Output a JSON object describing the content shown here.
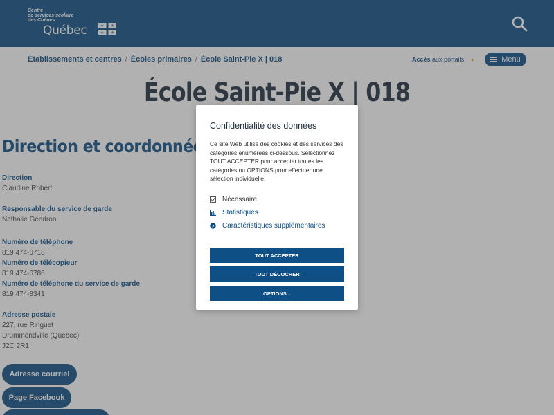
{
  "header": {
    "logo_line1": "Centre",
    "logo_line2": "de services scolaire",
    "logo_line3": "des Chênes",
    "logo_quebec": "Québec"
  },
  "breadcrumb": {
    "items": [
      "Établissements et centres",
      "Écoles primaires",
      "École Saint-Pie X | 018"
    ],
    "separator": "/"
  },
  "portals": {
    "bold": "Accès",
    "rest": "aux portails",
    "caret": "▼"
  },
  "menu": {
    "label": "Menu"
  },
  "page": {
    "title": "École Saint-Pie X | 018"
  },
  "contact": {
    "section_title": "Direction et coordonnées",
    "direction_label": "Direction",
    "direction_value": "Claudine Robert",
    "garde_label": "Responsable du service de garde",
    "garde_value": "Nathalie Gendron",
    "phone_label": "Numéro de téléphone",
    "phone_value": "819 474-0718",
    "fax_label": "Numéro de télécopieur",
    "fax_value": "819 474-0786",
    "garde_phone_label": "Numéro de téléphone du service de garde",
    "garde_phone_value": "819 474-8341",
    "address_label": "Adresse postale",
    "address_line1": "227, rue Ringuet",
    "address_line2": "Drummondville (Québec)",
    "address_line3": "J2C 2R1"
  },
  "buttons": {
    "email": "Adresse courriel",
    "facebook": "Page Facebook"
  },
  "modal": {
    "title": "Confidentialité des données",
    "text": "Ce site Web utilise des cookies et des services des catégories énumérées ci-dessous. Sélectionnez TOUT ACCEPTER pour accepter toutes les catégories ou OPTIONS pour effectuer une sélection individuelle.",
    "options": [
      "Nécessaire",
      "Statistiques",
      "Caractéristiques supplémentaires"
    ],
    "accept_all": "TOUT ACCEPTER",
    "uncheck_all": "TOUT DÉCOCHER",
    "options_btn": "OPTIONS..."
  },
  "colors": {
    "brand": "#0e4f86",
    "accent": "#e29a1d",
    "overlay": "rgba(70,70,70,0.42)"
  },
  "icons": [
    "search-icon",
    "menu-icon",
    "quebec-flag-icon",
    "checkbox-icon",
    "chart-icon",
    "puzzle-icon"
  ]
}
